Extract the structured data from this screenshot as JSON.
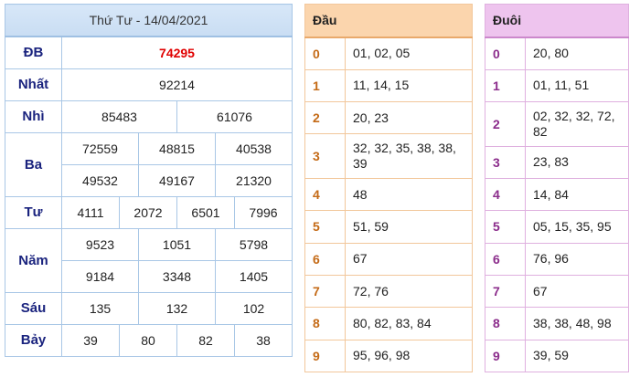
{
  "results": {
    "title": "Thứ Tư - 14/04/2021",
    "db": {
      "label": "ĐB",
      "values": [
        "74295"
      ]
    },
    "nhat": {
      "label": "Nhất",
      "values": [
        "92214"
      ]
    },
    "nhi": {
      "label": "Nhì",
      "values": [
        "85483",
        "61076"
      ]
    },
    "ba": {
      "label": "Ba",
      "values": [
        "72559",
        "48815",
        "40538",
        "49532",
        "49167",
        "21320"
      ]
    },
    "tu": {
      "label": "Tư",
      "values": [
        "4111",
        "2072",
        "6501",
        "7996"
      ]
    },
    "nam": {
      "label": "Năm",
      "values": [
        "9523",
        "1051",
        "5798",
        "9184",
        "3348",
        "1405"
      ]
    },
    "sau": {
      "label": "Sáu",
      "values": [
        "135",
        "132",
        "102"
      ]
    },
    "bay": {
      "label": "Bảy",
      "values": [
        "39",
        "80",
        "82",
        "38"
      ]
    }
  },
  "dau": {
    "header": "Đầu",
    "rows": [
      {
        "digit": "0",
        "values": "01, 02, 05"
      },
      {
        "digit": "1",
        "values": "11, 14, 15"
      },
      {
        "digit": "2",
        "values": "20, 23"
      },
      {
        "digit": "3",
        "values": "32, 32, 35, 38, 38, 39"
      },
      {
        "digit": "4",
        "values": "48"
      },
      {
        "digit": "5",
        "values": "51, 59"
      },
      {
        "digit": "6",
        "values": "67"
      },
      {
        "digit": "7",
        "values": "72, 76"
      },
      {
        "digit": "8",
        "values": "80, 82, 83, 84"
      },
      {
        "digit": "9",
        "values": "95, 96, 98"
      }
    ]
  },
  "duoi": {
    "header": "Đuôi",
    "rows": [
      {
        "digit": "0",
        "values": "20, 80"
      },
      {
        "digit": "1",
        "values": "01, 11, 51"
      },
      {
        "digit": "2",
        "values": "02, 32, 32, 72, 82"
      },
      {
        "digit": "3",
        "values": "23, 83"
      },
      {
        "digit": "4",
        "values": "14, 84"
      },
      {
        "digit": "5",
        "values": "05, 15, 35, 95"
      },
      {
        "digit": "6",
        "values": "76, 96"
      },
      {
        "digit": "7",
        "values": "67"
      },
      {
        "digit": "8",
        "values": "38, 38, 48, 98"
      },
      {
        "digit": "9",
        "values": "39, 59"
      }
    ]
  },
  "colors": {
    "special_prize": "#e00000",
    "label": "#1a237e",
    "dau_accent": "#fbd5ad",
    "duoi_accent": "#eec4ee"
  }
}
